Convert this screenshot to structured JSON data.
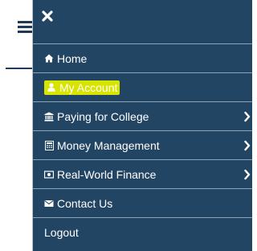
{
  "colors": {
    "panel_bg": "#234564",
    "divider": "#8fa3b6",
    "active_highlight": "#d7e400",
    "text": "#ffffff",
    "page_accent": "#1e3a5a"
  },
  "header": {
    "close_icon": "close-icon",
    "menu_icon": "hamburger-icon"
  },
  "menu": {
    "items": [
      {
        "label": "Home",
        "icon": "home-icon",
        "has_submenu": false,
        "active": false
      },
      {
        "label": "My Account",
        "icon": "user-icon",
        "has_submenu": false,
        "active": true
      },
      {
        "label": "Paying for College",
        "icon": "bank-icon",
        "has_submenu": true,
        "active": false
      },
      {
        "label": "Money Management",
        "icon": "calculator-icon",
        "has_submenu": true,
        "active": false
      },
      {
        "label": "Real-World Finance",
        "icon": "money-bill-icon",
        "has_submenu": true,
        "active": false
      },
      {
        "label": "Contact Us",
        "icon": "envelope-icon",
        "has_submenu": false,
        "active": false
      },
      {
        "label": "Logout",
        "icon": "",
        "has_submenu": false,
        "active": false
      }
    ]
  }
}
